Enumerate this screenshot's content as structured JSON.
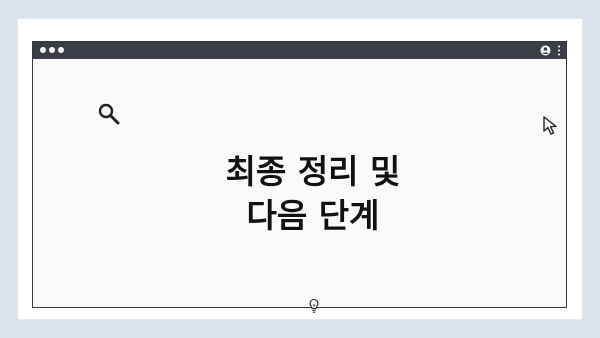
{
  "headline": {
    "line1": "최종 정리 및",
    "line2": "다음 단계"
  },
  "icons": {
    "search": "search-icon",
    "cursor": "cursor-arrow-icon",
    "idea": "lightbulb-icon",
    "user": "user-icon",
    "menu": "kebab-menu-icon"
  },
  "colors": {
    "background": "#dde3ec",
    "titlebar": "#3b3f45",
    "text": "#111111"
  }
}
